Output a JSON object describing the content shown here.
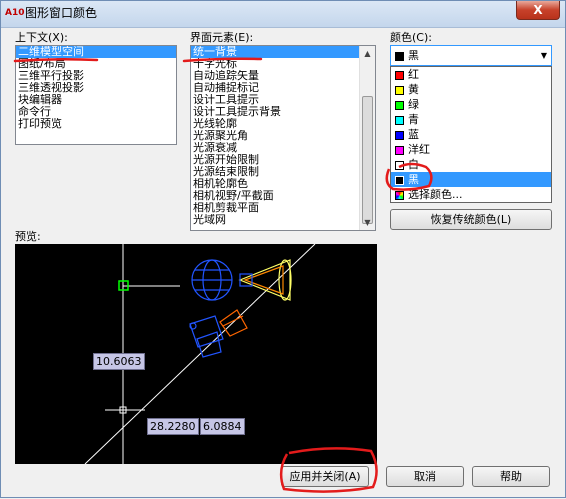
{
  "window": {
    "title": "图形窗口颜色",
    "app_icon_text": "A10",
    "close_label": "X"
  },
  "context": {
    "label": "上下文(X):",
    "items": [
      "二维模型空间",
      "图纸/布局",
      "三维平行投影",
      "三维透视投影",
      "块编辑器",
      "命令行",
      "打印预览"
    ],
    "selected_index": 0
  },
  "elements": {
    "label": "界面元素(E):",
    "items": [
      "统一背景",
      "十字光标",
      "自动追踪矢量",
      "自动捕捉标记",
      "设计工具提示",
      "设计工具提示背景",
      "光线轮廓",
      "光源聚光角",
      "光源衰减",
      "光源开始限制",
      "光源结束限制",
      "相机轮廓色",
      "相机视野/平截面",
      "相机剪裁平面",
      "光域网"
    ],
    "selected_index": 0
  },
  "color": {
    "label": "颜色(C):",
    "current": "黑",
    "current_hex": "#000000",
    "options": [
      {
        "name": "红",
        "hex": "#ff0000"
      },
      {
        "name": "黄",
        "hex": "#ffff00"
      },
      {
        "name": "绿",
        "hex": "#00ff00"
      },
      {
        "name": "青",
        "hex": "#00ffff"
      },
      {
        "name": "蓝",
        "hex": "#0000ff"
      },
      {
        "name": "洋红",
        "hex": "#ff00ff"
      },
      {
        "name": "白",
        "hex": "#ffffff"
      },
      {
        "name": "黑",
        "hex": "#000000"
      },
      {
        "name": "选择颜色...",
        "hex": "multicolor"
      }
    ],
    "selected_index": 7,
    "restore_button": "恢复传统颜色(L)"
  },
  "preview": {
    "label": "预览:",
    "dim_vertical": "10.6063",
    "dim_x": "28.2280",
    "dim_y": "6.0884"
  },
  "buttons": {
    "apply_close": "应用并关闭(A)",
    "cancel": "取消",
    "help": "帮助"
  },
  "colors": {
    "selection": "#3399ff",
    "annotation_red": "#e31b1b",
    "crosshair_green": "#00ff00",
    "object_blue": "#2255ff"
  }
}
